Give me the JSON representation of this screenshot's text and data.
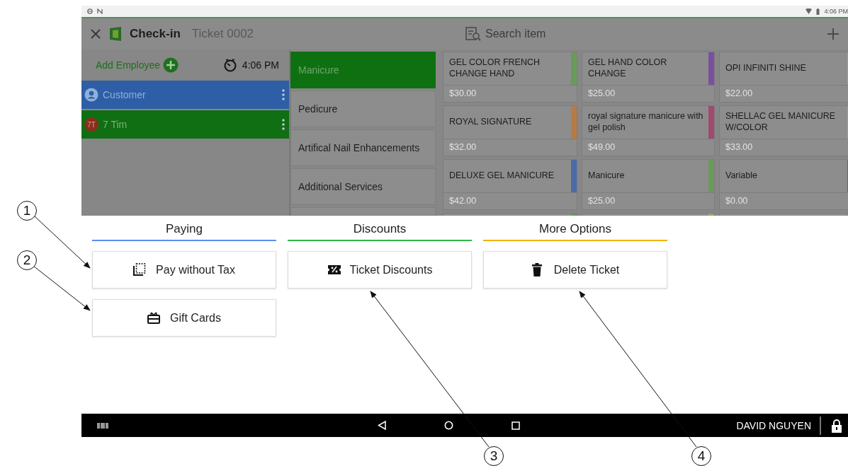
{
  "status_bar": {
    "time": "4:06 PM"
  },
  "header": {
    "title": "Check-in",
    "ticket": "Ticket 0002",
    "search": {
      "placeholder": "Search item"
    }
  },
  "employee_panel": {
    "add_label": "Add Employee",
    "time": "4:06 PM",
    "rows": [
      {
        "name": "Customer",
        "kind": "customer"
      },
      {
        "name": "7 Tim",
        "kind": "employee",
        "initials": "7T"
      }
    ]
  },
  "categories": [
    {
      "label": "Manicure",
      "selected": true
    },
    {
      "label": "Pedicure",
      "selected": false
    },
    {
      "label": "Artifical Nail Enhancements",
      "selected": false
    },
    {
      "label": "Additional Services",
      "selected": false
    }
  ],
  "items": [
    {
      "name": "GEL COLOR FRENCH CHANGE HAND",
      "price": "$30.00",
      "color": "#6a9a5a"
    },
    {
      "name": "GEL HAND COLOR CHANGE",
      "price": "$25.00",
      "color": "#7a4fa0"
    },
    {
      "name": "OPI INFINITI SHINE",
      "price": "$22.00",
      "color": "#a8a060"
    },
    {
      "name": "ROYAL SIGNATURE",
      "price": "$32.00",
      "color": "#b87a45"
    },
    {
      "name": "royal signature manicure with gel polish",
      "price": "$49.00",
      "color": "#a04a70"
    },
    {
      "name": "SHELLAC GEL MANICURE W/COLOR",
      "price": "$33.00",
      "color": "#a8a060"
    },
    {
      "name": "DELUXE GEL MANICURE",
      "price": "$42.00",
      "color": "#4a6aa8"
    },
    {
      "name": "Manicure",
      "price": "$25.00",
      "color": "#6a9a5a"
    },
    {
      "name": "Variable",
      "price": "$0.00",
      "color": "#7a4fa0"
    },
    {
      "color": "#6a9a5a"
    },
    {
      "color": "#a8a060"
    },
    {
      "color": "#3aa0a8"
    }
  ],
  "sheet": {
    "sections": [
      {
        "title": "Paying",
        "color": "#5b8def",
        "buttons": [
          {
            "label": "Pay without Tax",
            "kind": "no-tax"
          },
          {
            "label": "Gift Cards",
            "kind": "gift"
          }
        ]
      },
      {
        "title": "Discounts",
        "color": "#2eb84a",
        "buttons": [
          {
            "label": "Ticket Discounts",
            "kind": "discount"
          }
        ]
      },
      {
        "title": "More Options",
        "color": "#f0b400",
        "buttons": [
          {
            "label": "Delete Ticket",
            "kind": "delete"
          }
        ]
      }
    ]
  },
  "nav_bar": {
    "user": "DAVID NGUYEN"
  },
  "callouts": [
    "1",
    "2",
    "3",
    "4"
  ]
}
